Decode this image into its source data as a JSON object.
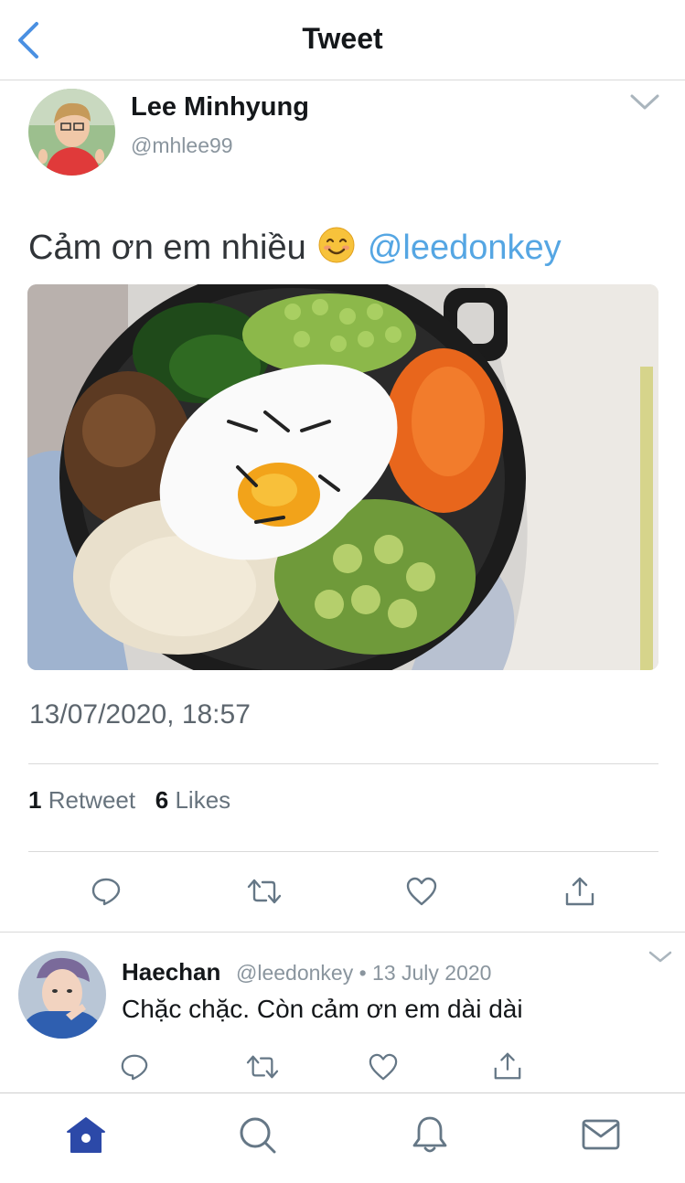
{
  "header": {
    "title": "Tweet",
    "back_icon": "chevron-left-icon"
  },
  "tweet": {
    "author_name": "Lee Minhyung",
    "author_handle": "@mhlee99",
    "text": "Cảm ơn em nhiều",
    "emoji": "smiling-face-emoji",
    "mention": "@leedonkey",
    "timestamp": "13/07/2020, 18:57",
    "retweet_count": "1",
    "retweet_label": "Retweet",
    "like_count": "6",
    "like_label": "Likes"
  },
  "reply": {
    "author_name": "Haechan",
    "meta": "@leedonkey • 13 July 2020",
    "text": "Chặc chặc. Còn cảm ơn em dài dài"
  },
  "tabs": [
    "home-icon",
    "search-icon",
    "bell-icon",
    "mail-icon"
  ],
  "colors": {
    "accent": "#1da1f2",
    "mention": "#55a6e3",
    "tab_active": "#2c49a8",
    "icon_gray": "#657786"
  }
}
